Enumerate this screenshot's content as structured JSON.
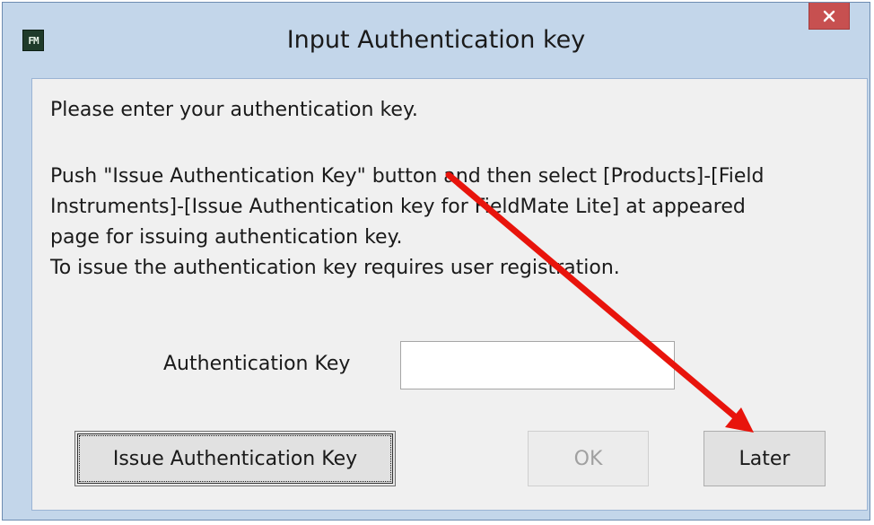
{
  "window": {
    "title": "Input Authentication key",
    "app_icon_text": "FM",
    "close_glyph": "close-icon"
  },
  "content": {
    "intro": "Please enter your authentication key.",
    "instructions": [
      "Push \"Issue Authentication Key\" button and then select [Products]-[Field",
      "Instruments]-[Issue Authentication key for FieldMate Lite] at appeared",
      "page for issuing authentication key.",
      "To issue the authentication key  requires user registration."
    ]
  },
  "form": {
    "auth_key_label": "Authentication Key",
    "auth_key_value": "",
    "auth_key_placeholder": ""
  },
  "buttons": {
    "issue_label": "Issue Authentication Key",
    "ok_label": "OK",
    "later_label": "Later",
    "ok_disabled": true
  },
  "annotation": {
    "arrow_color": "#e8140c"
  },
  "colors": {
    "title_bg": "#c3d6ea",
    "close_bg": "#c75050",
    "client_bg": "#f0f0f0"
  }
}
